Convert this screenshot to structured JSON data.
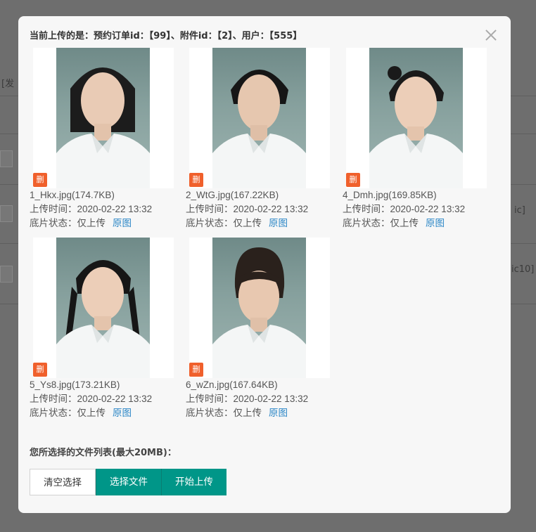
{
  "background": {
    "left_fragment": "[发",
    "right_fragment_1": "ic]",
    "right_fragment_2": "ic10]"
  },
  "modal": {
    "title": "当前上传的是：预约订单id：【99】、附件id：【2】、用户：【555】",
    "close_label": ""
  },
  "photos": [
    {
      "delete_label": "删",
      "filename": "1_Hkx.jpg(174.7KB)",
      "upload_time": "上传时间：2020-02-22 13:32",
      "status": "底片状态：仅上传",
      "original_link": "原图"
    },
    {
      "delete_label": "删",
      "filename": "2_WtG.jpg(167.22KB)",
      "upload_time": "上传时间：2020-02-22 13:32",
      "status": "底片状态：仅上传",
      "original_link": "原图"
    },
    {
      "delete_label": "删",
      "filename": "4_Dmh.jpg(169.85KB)",
      "upload_time": "上传时间：2020-02-22 13:32",
      "status": "底片状态：仅上传",
      "original_link": "原图"
    },
    {
      "delete_label": "删",
      "filename": "5_Ys8.jpg(173.21KB)",
      "upload_time": "上传时间：2020-02-22 13:32",
      "status": "底片状态：仅上传",
      "original_link": "原图"
    },
    {
      "delete_label": "删",
      "filename": "6_wZn.jpg(167.64KB)",
      "upload_time": "上传时间：2020-02-22 13:32",
      "status": "底片状态：仅上传",
      "original_link": "原图"
    }
  ],
  "file_list": {
    "title": "您所选择的文件列表(最大20MB)："
  },
  "buttons": {
    "clear": "清空选择",
    "choose": "选择文件",
    "upload": "开始上传"
  },
  "colors": {
    "accent": "#009688",
    "delete_badge": "#f0602c",
    "link": "#2a86c6"
  }
}
